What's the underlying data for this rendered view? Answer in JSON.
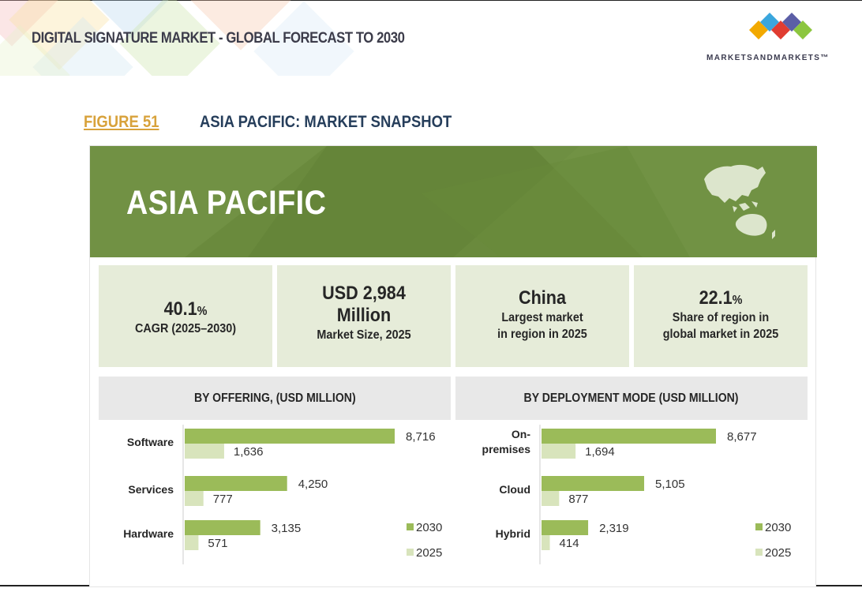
{
  "header": {
    "title": "DIGITAL SIGNATURE MARKET - GLOBAL FORECAST TO 2030",
    "logo_text": "MARKETSANDMARKETS™"
  },
  "figure": {
    "label": "FIGURE 51",
    "title": "ASIA PACIFIC: MARKET SNAPSHOT"
  },
  "banner": {
    "title": "ASIA PACIFIC"
  },
  "kpis": [
    {
      "big": "40.1",
      "unit": "%",
      "caption1": "CAGR (2025–2030)",
      "caption2": ""
    },
    {
      "big": "USD 2,984",
      "big2": "Million",
      "caption1": "Market Size, 2025"
    },
    {
      "big": "China",
      "caption1": "Largest market",
      "caption2": "in region in 2025"
    },
    {
      "big": "22.1",
      "unit": "%",
      "caption1": "Share of region in",
      "caption2": "global market in 2025"
    }
  ],
  "colors": {
    "series_2030": "#9bbb59",
    "series_2025": "#d8e4bc",
    "banner": "#6a8a3d",
    "kpi_bg": "#e6ecd9"
  },
  "chart_data": [
    {
      "type": "bar",
      "title": "BY OFFERING, (USD MILLION)",
      "orientation": "horizontal",
      "categories": [
        "Software",
        "Services",
        "Hardware"
      ],
      "series": [
        {
          "name": "2030",
          "values": [
            8716,
            4250,
            3135
          ],
          "labels": [
            "8,716",
            "4,250",
            "3,135"
          ]
        },
        {
          "name": "2025",
          "values": [
            1636,
            777,
            571
          ],
          "labels": [
            "1,636",
            "777",
            "571"
          ]
        }
      ],
      "xlim": [
        0,
        8716
      ],
      "legend": "bottom-right"
    },
    {
      "type": "bar",
      "title": "BY DEPLOYMENT MODE (USD MILLION)",
      "orientation": "horizontal",
      "categories": [
        "On-premises",
        "Cloud",
        "Hybrid"
      ],
      "category_lines": [
        [
          "On-",
          "premises"
        ],
        [
          "Cloud"
        ],
        [
          "Hybrid"
        ]
      ],
      "series": [
        {
          "name": "2030",
          "values": [
            8677,
            5105,
            2319
          ],
          "labels": [
            "8,677",
            "5,105",
            "2,319"
          ]
        },
        {
          "name": "2025",
          "values": [
            1694,
            877,
            414
          ],
          "labels": [
            "1,694",
            "877",
            "414"
          ]
        }
      ],
      "xlim": [
        0,
        8677
      ],
      "legend": "bottom-right"
    }
  ]
}
